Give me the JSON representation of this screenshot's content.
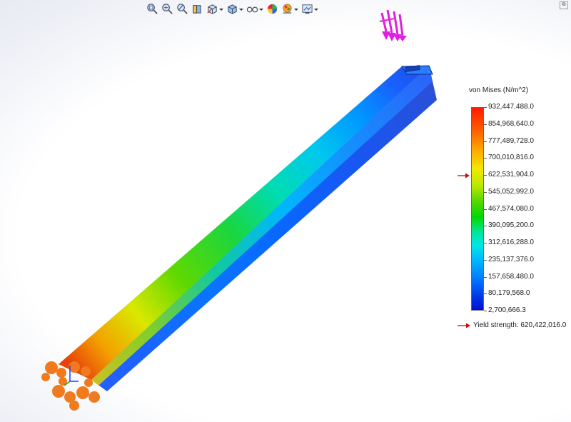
{
  "toolbar": {
    "buttons": [
      {
        "icon": "zoom-to-fit-icon",
        "dropdown": false
      },
      {
        "icon": "zoom-to-area-icon",
        "dropdown": false
      },
      {
        "icon": "previous-view-icon",
        "dropdown": false
      },
      {
        "icon": "section-view-icon",
        "dropdown": false
      },
      {
        "icon": "view-orientation-icon",
        "dropdown": true
      },
      {
        "icon": "display-style-icon",
        "dropdown": true
      },
      {
        "icon": "hide-show-items-icon",
        "dropdown": true
      },
      {
        "icon": "edit-appearance-icon",
        "dropdown": false
      },
      {
        "icon": "apply-scene-icon",
        "dropdown": true
      },
      {
        "icon": "view-settings-icon",
        "dropdown": true
      }
    ]
  },
  "legend": {
    "title": "von Mises (N/m^2)",
    "values": [
      "932,447,488.0",
      "854,968,640.0",
      "777,489,728.0",
      "700,010,816.0",
      "622,531,904.0",
      "545,052,992.0",
      "467,574,080.0",
      "390,095,200.0",
      "312,616,288.0",
      "235,137,376.0",
      "157,658,480.0",
      "80,179,568.0",
      "2,700,666.3"
    ],
    "max": 932447488.0,
    "min": 2700666.3,
    "yield_strength_value": 620422016.0,
    "yield_label": "Yield strength: 620,422,016.0",
    "marker_color": "#e00000"
  },
  "model": {
    "load_arrow_color": "#e020e0",
    "fixture_color": "#f07a1e"
  }
}
